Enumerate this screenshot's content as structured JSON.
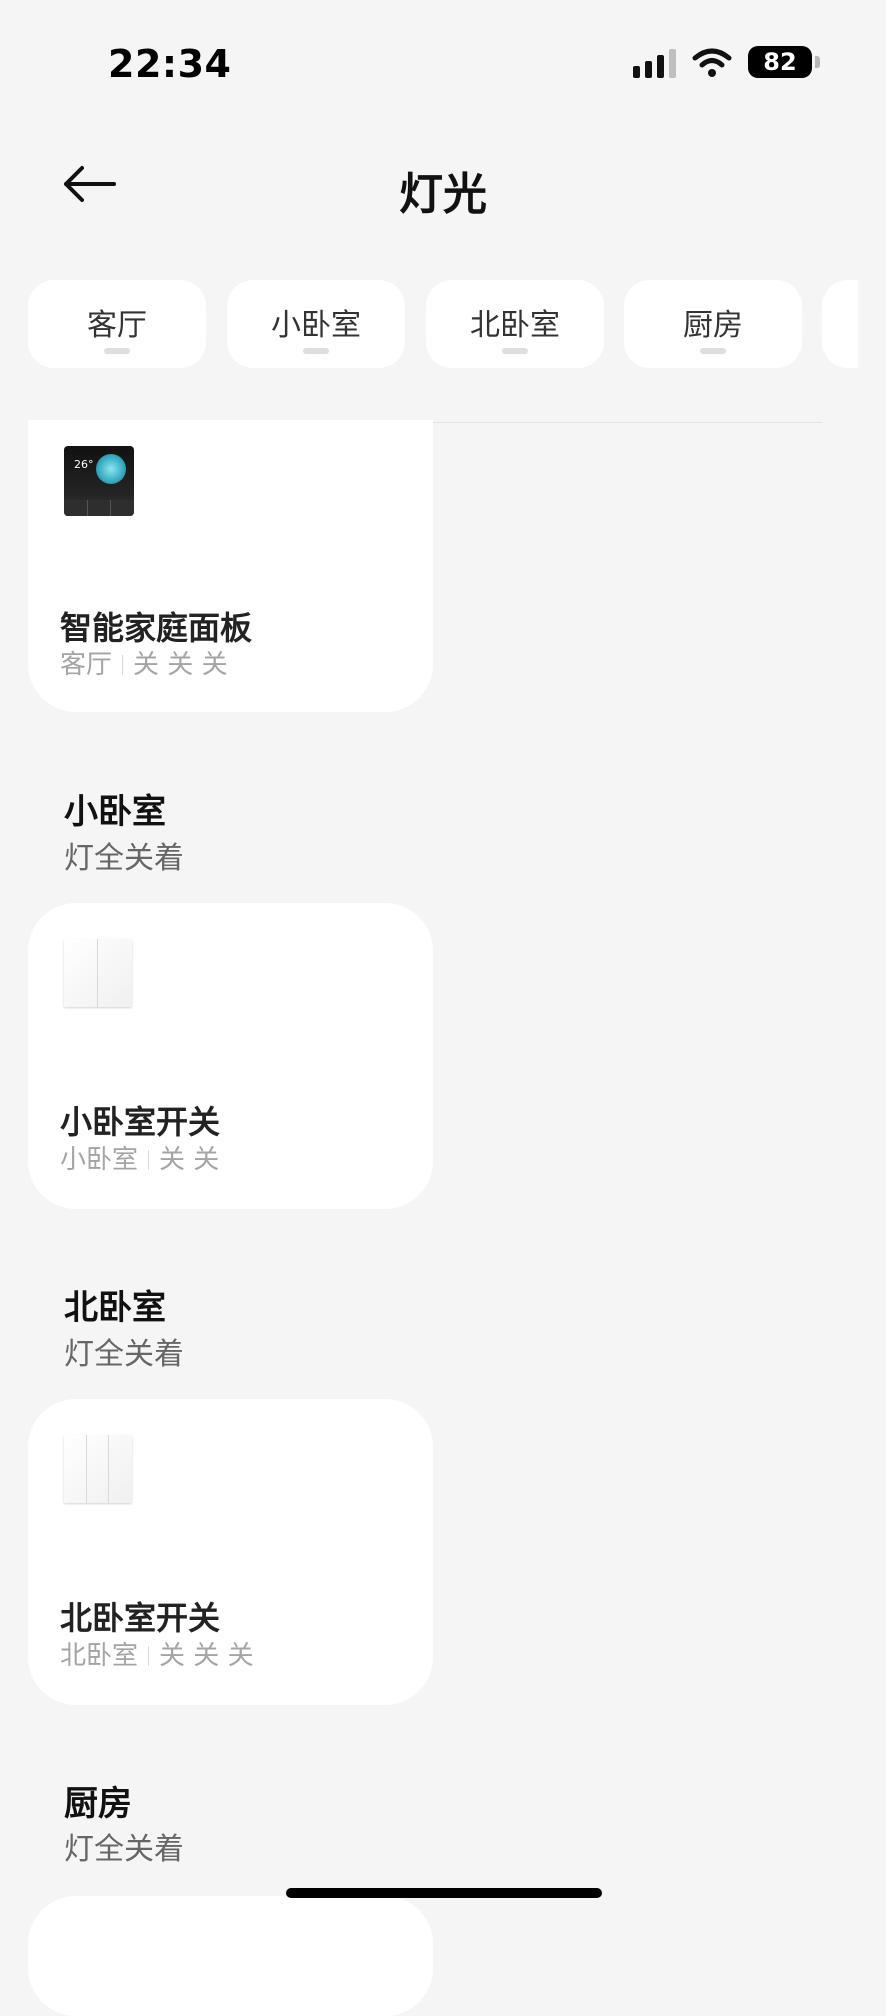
{
  "status_bar": {
    "time": "22:34",
    "battery": "82",
    "icons": [
      "signal-icon",
      "wifi-icon",
      "battery-icon"
    ]
  },
  "header": {
    "title": "灯光",
    "back_icon": "back-arrow-icon"
  },
  "tabs": [
    {
      "label": "客厅"
    },
    {
      "label": "小卧室"
    },
    {
      "label": "北卧室"
    },
    {
      "label": "厨房"
    }
  ],
  "devices": {
    "panel": {
      "name": "智能家庭面板",
      "room": "客厅",
      "states": [
        "关",
        "关",
        "关"
      ],
      "screen_temp": "26°"
    },
    "small_switch": {
      "name": "小卧室开关",
      "room": "小卧室",
      "states": [
        "关",
        "关"
      ]
    },
    "north_switch": {
      "name": "北卧室开关",
      "room": "北卧室",
      "states": [
        "关",
        "关",
        "关"
      ]
    }
  },
  "sections": [
    {
      "title": "小卧室",
      "status": "灯全关着"
    },
    {
      "title": "北卧室",
      "status": "灯全关着"
    },
    {
      "title": "厨房",
      "status": "灯全关着"
    }
  ],
  "colors": {
    "background": "#f5f5f5",
    "card": "#ffffff",
    "text": "#111111",
    "muted": "#a4a4a4"
  }
}
